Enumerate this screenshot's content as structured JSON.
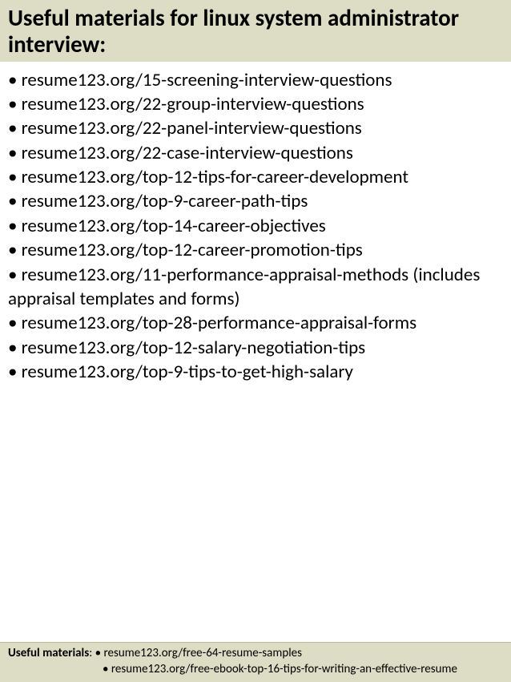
{
  "header": {
    "title": "Useful materials for linux system administrator interview:"
  },
  "main": {
    "items": [
      "• resume123.org/15-screening-interview-questions",
      "• resume123.org/22-group-interview-questions",
      "• resume123.org/22-panel-interview-questions",
      "• resume123.org/22-case-interview-questions",
      "• resume123.org/top-12-tips-for-career-development",
      "• resume123.org/top-9-career-path-tips",
      "• resume123.org/top-14-career-objectives",
      "• resume123.org/top-12-career-promotion-tips",
      "• resume123.org/11-performance-appraisal-methods (includes appraisal templates and forms)",
      "• resume123.org/top-28-performance-appraisal-forms",
      "• resume123.org/top-12-salary-negotiation-tips",
      "• resume123.org/top-9-tips-to-get-high-salary"
    ]
  },
  "footer": {
    "label": "Useful materials",
    "sep": ": ",
    "line1": "• resume123.org/free-64-resume-samples",
    "line2": "• resume123.org/free-ebook-top-16-tips-for-writing-an-effective-resume"
  }
}
